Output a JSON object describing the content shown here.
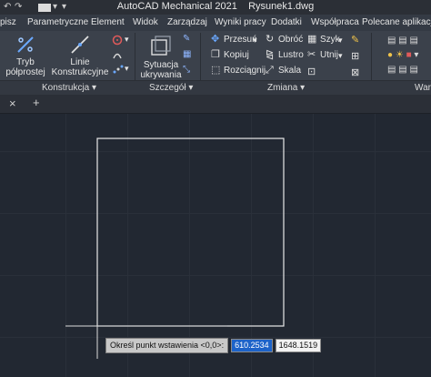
{
  "app": {
    "title": "AutoCAD Mechanical 2021",
    "document": "Rysunek1.dwg"
  },
  "menu": [
    "pisz",
    "Parametryczne",
    "Element",
    "Widok",
    "Zarządzaj",
    "Wyniki pracy",
    "Dodatki",
    "Współpraca",
    "Polecane aplikacje"
  ],
  "ribbon": {
    "konstrukcja": {
      "title": "Konstrukcja",
      "tryb_line1": "Tryb",
      "tryb_line2": "półprostej",
      "linie_line1": "Linie",
      "linie_line2": "Konstrukcyjne"
    },
    "szczegol": {
      "title": "Szczegół",
      "sytuacja_line1": "Sytuacja",
      "sytuacja_line2": "ukrywania"
    },
    "zmiana": {
      "title": "Zmiana",
      "przesun": "Przesuń",
      "obroc": "Obróć",
      "szyk": "Szyk",
      "kopiuj": "Kopiuj",
      "lustro": "Lustro",
      "utnij": "Utnij",
      "rozciagnij": "Rozciągnij",
      "skala": "Skala"
    },
    "war": {
      "title": "War"
    }
  },
  "tabs": {
    "close": "×",
    "add": "+"
  },
  "command_prompt": {
    "label": "Określ punkt wstawienia <0,0>:",
    "x_value": "610.2534",
    "y_value": "1648.1519"
  },
  "colors": {
    "accent": "#1d63c9",
    "canvas": "#222832",
    "ribbon": "#3b414b"
  }
}
